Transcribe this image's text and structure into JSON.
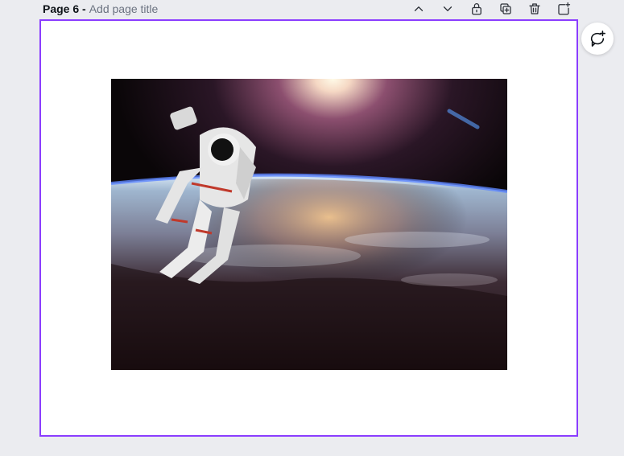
{
  "page_header": {
    "label": "Page 6 -",
    "title_placeholder": "Add page title"
  },
  "toolbar": {
    "items": [
      {
        "name": "move-up",
        "icon": "chevron-up-icon"
      },
      {
        "name": "move-down",
        "icon": "chevron-down-icon"
      },
      {
        "name": "lock",
        "icon": "lock-icon"
      },
      {
        "name": "duplicate",
        "icon": "duplicate-icon"
      },
      {
        "name": "delete",
        "icon": "trash-icon"
      },
      {
        "name": "add-page",
        "icon": "add-page-icon"
      }
    ]
  },
  "canvas": {
    "selection_color": "#8b3dff",
    "background": "#ffffff",
    "image_subject": "astronaut floating above earth"
  },
  "comment_button": {
    "icon": "add-comment-icon"
  }
}
